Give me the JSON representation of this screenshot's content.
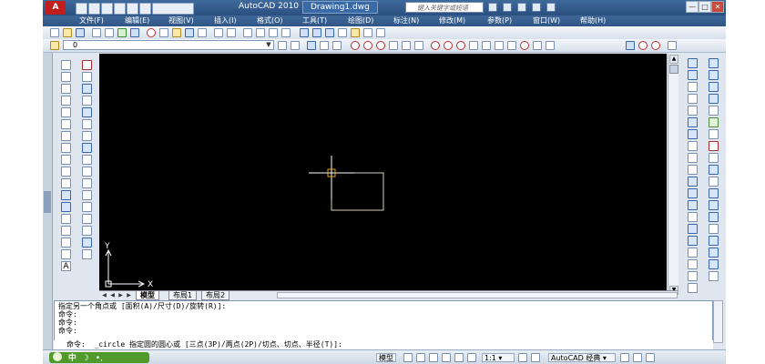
{
  "title_bar": {
    "app_logo": "A",
    "app_title": "AutoCAD 2010",
    "drawing_name": "Drawing1.dwg",
    "search_placeholder": "键入关键字或短语",
    "window_controls": [
      "—",
      "□",
      "✕"
    ]
  },
  "menu": {
    "items": [
      "文件(F)",
      "编辑(E)",
      "视图(V)",
      "插入(I)",
      "格式(O)",
      "工具(T)",
      "绘图(D)",
      "标注(N)",
      "修改(M)",
      "参数(P)",
      "窗口(W)",
      "帮助(H)"
    ]
  },
  "layer_toolbar": {
    "layer_value": "0"
  },
  "canvas": {
    "background": "#000000",
    "ucs_x_label": "X",
    "ucs_y_label": "Y"
  },
  "layout_tabs": [
    "模型",
    "布局1",
    "布局2"
  ],
  "command_line": {
    "history": [
      "指定另一个角点或 [面积(A)/尺寸(D)/旋转(R)]:",
      "命令:",
      "命令:",
      "命令:"
    ],
    "prompt": "命令:",
    "current": "_circle 指定圆的圆心或 [三点(3P)/两点(2P)/切点、切点、半径(T)]:"
  },
  "status_bar": {
    "ime_label": "中",
    "ime_glyph": "☽",
    "model_label": "模型",
    "scale_label": "1:1",
    "workspace_label": "AutoCAD 经典"
  },
  "colors": {
    "title_bar": "#2f5686",
    "canvas": "#000000",
    "crosshair": "#ffffff",
    "rect_line": "#d8d0c0",
    "grip": "#e8a020",
    "ime": "#4f9a2a"
  }
}
